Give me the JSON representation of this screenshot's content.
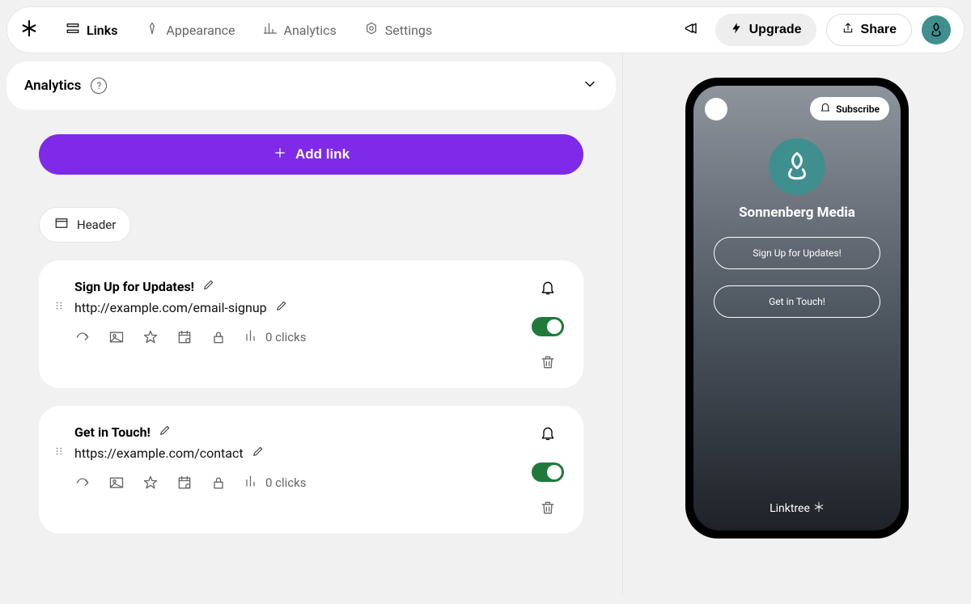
{
  "nav": {
    "links": "Links",
    "appearance": "Appearance",
    "analytics": "Analytics",
    "settings": "Settings"
  },
  "topbar": {
    "upgrade": "Upgrade",
    "share": "Share"
  },
  "panel": {
    "analytics_title": "Analytics",
    "help_glyph": "?"
  },
  "buttons": {
    "add_link": "Add link",
    "header": "Header"
  },
  "links": [
    {
      "title": "Sign Up for Updates!",
      "url": "http://example.com/email-signup",
      "clicks": "0 clicks",
      "enabled": true
    },
    {
      "title": "Get in Touch!",
      "url": "https://example.com/contact",
      "clicks": "0 clicks",
      "enabled": true
    }
  ],
  "preview": {
    "subscribe": "Subscribe",
    "profile_name": "Sonnenberg Media",
    "links": [
      "Sign Up for Updates!",
      "Get in Touch!"
    ],
    "footer": "Linktree"
  }
}
